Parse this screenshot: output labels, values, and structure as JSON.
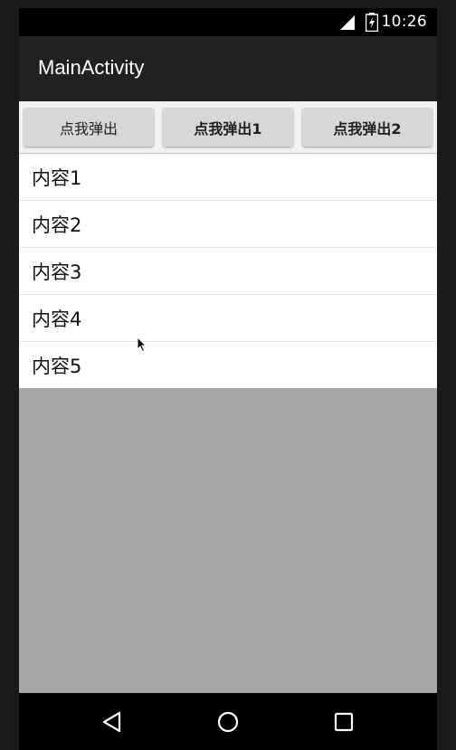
{
  "status_bar": {
    "time": "10:26",
    "icons": [
      "signal-icon",
      "battery-icon"
    ]
  },
  "action_bar": {
    "title": "MainActivity"
  },
  "buttons": [
    {
      "label": "点我弹出"
    },
    {
      "label": "点我弹出1"
    },
    {
      "label": "点我弹出2"
    }
  ],
  "list": {
    "items": [
      {
        "label": "内容1"
      },
      {
        "label": "内容2"
      },
      {
        "label": "内容3"
      },
      {
        "label": "内容4"
      },
      {
        "label": "内容5"
      }
    ]
  },
  "nav_bar": {
    "icons": [
      "back-icon",
      "home-icon",
      "recents-icon"
    ]
  },
  "colors": {
    "status_bar": "#000000",
    "action_bar": "#212121",
    "button": "#d6d7d7",
    "dim_background": "#a6a6a6",
    "list_background": "#ffffff"
  }
}
